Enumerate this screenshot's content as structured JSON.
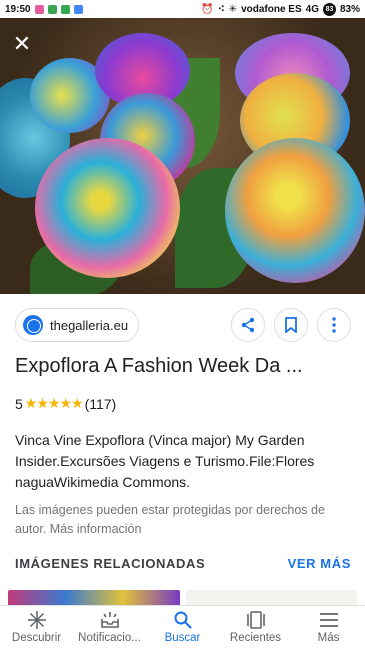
{
  "status_bar": {
    "time": "19:50",
    "carrier": "vodafone ES",
    "network": "4G",
    "battery_badge": "83",
    "battery": "83%"
  },
  "hero": {
    "close_icon": "close-icon",
    "image_subject": "rainbow roses"
  },
  "source": {
    "name": "thegalleria.eu"
  },
  "result": {
    "title": "Expoflora A Fashion Week Da ...",
    "rating_value": "5",
    "stars": "★★★★★",
    "review_count": "(117)",
    "description": "Vinca Vine Expoflora (Vinca major) My Garden Insider.Excursões Viagens e Turismo.File:Flores naguaWikimedia Commons.",
    "notice": "Las imágenes pueden estar protegidas por derechos de autor. Más información"
  },
  "related": {
    "title": "IMÁGENES RELACIONADAS",
    "see_more": "VER MÁS"
  },
  "bottom_nav": {
    "items": [
      {
        "label": "Descubrir",
        "icon": "asterisk-icon"
      },
      {
        "label": "Notificacio...",
        "icon": "inbox-icon"
      },
      {
        "label": "Buscar",
        "icon": "search-icon"
      },
      {
        "label": "Recientes",
        "icon": "tabs-icon"
      },
      {
        "label": "Más",
        "icon": "menu-icon"
      }
    ]
  },
  "colors": {
    "accent": "#1a73e8",
    "star": "#f4b400",
    "text": "#202124",
    "muted": "#70757a"
  }
}
